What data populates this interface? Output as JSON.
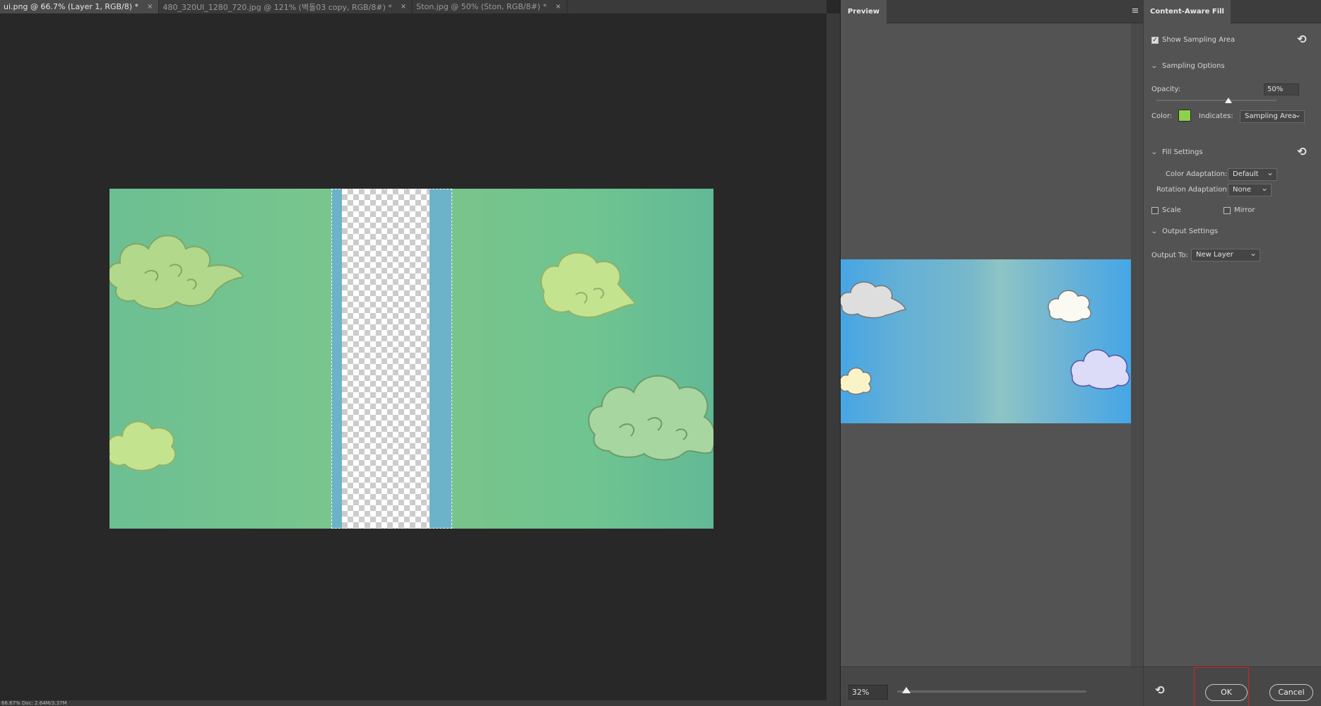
{
  "tabs": [
    {
      "label": "ui.png @ 66.7% (Layer 1, RGB/8) *",
      "close": "×",
      "active": true
    },
    {
      "label": "480_320UI_1280_720.jpg @ 121% (벽돌03 copy, RGB/8#) *",
      "close": "×",
      "active": false
    },
    {
      "label": "Ston.jpg @ 50% (Ston, RGB/8#) *",
      "close": "×",
      "active": false
    }
  ],
  "status_text": "66.67%   Doc: 2.64M/3.37M",
  "preview_panel": {
    "title": "Preview",
    "menu_icon": "panel-menu-icon",
    "zoom_value": "32%",
    "zoom_level": 0.05
  },
  "caf": {
    "title": "Content-Aware Fill",
    "show_sampling_area": "Show Sampling Area",
    "sampling_options": "Sampling Options",
    "opacity_label": "Opacity:",
    "opacity_value": "50%",
    "opacity_level": 0.6,
    "color_label": "Color:",
    "color_hex": "#8bd14a",
    "indicates_label": "Indicates:",
    "indicates_value": "Sampling Area",
    "fill_settings": "Fill Settings",
    "color_adaptation_label": "Color Adaptation:",
    "color_adaptation_value": "Default",
    "rotation_adaptation_label": "Rotation Adaptation:",
    "rotation_adaptation_value": "None",
    "scale_label": "Scale",
    "mirror_label": "Mirror",
    "output_settings": "Output Settings",
    "output_to_label": "Output To:",
    "output_to_value": "New Layer",
    "ok_label": "OK",
    "cancel_label": "Cancel"
  }
}
